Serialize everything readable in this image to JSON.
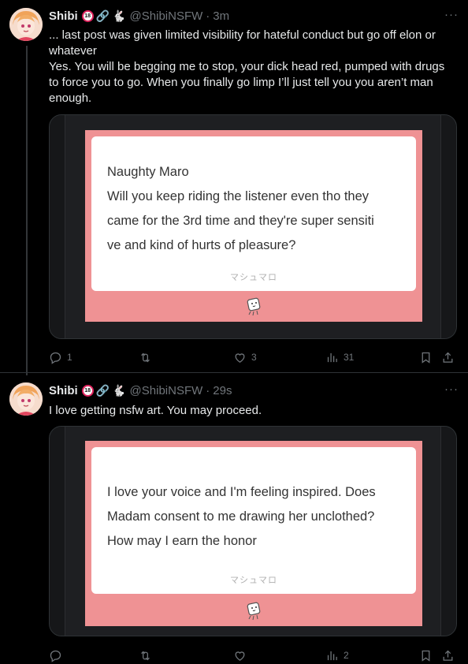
{
  "tweets": [
    {
      "name": "Shibi",
      "badge_18": "18",
      "handle": "@ShibiNSFW",
      "time": "3m",
      "more": "···",
      "text_lines": [
        "... last post was given limited visibility for hateful conduct but go off elon or whatever",
        "Yes. You will be begging me to stop, your dick head red, pumped with drugs to force you to go. When you finally go limp I’ll just tell you you aren’t man enough."
      ],
      "card": {
        "lines": [
          "Naughty Maro",
          "Will you keep riding the listener even tho they",
          "came for the 3rd time and they're super sensiti",
          "ve and kind of hurts of pleasure?"
        ],
        "brand": "マシュマロ"
      },
      "stats": {
        "replies": "1",
        "retweets": "",
        "likes": "3",
        "views": "31"
      }
    },
    {
      "name": "Shibi",
      "badge_18": "18",
      "handle": "@ShibiNSFW",
      "time": "29s",
      "more": "···",
      "text_lines": [
        "I love getting nsfw art. You may proceed."
      ],
      "card": {
        "lines": [
          "I love your voice and I'm feeling inspired. Does",
          "Madam consent to me drawing her unclothed?",
          "How may I earn the honor"
        ],
        "brand": "マシュマロ"
      },
      "stats": {
        "replies": "",
        "retweets": "",
        "likes": "",
        "views": "2"
      }
    }
  ],
  "colors": {
    "background": "#000000",
    "text": "#e7e9ea",
    "muted": "#71767b",
    "card_pink": "#ef9294",
    "divider": "#2f3336"
  },
  "icons": [
    "reply-icon",
    "retweet-icon",
    "like-icon",
    "views-icon",
    "bookmark-icon",
    "share-icon",
    "link-badge-icon",
    "rabbit-badge-icon",
    "marshmallow-mascot-icon"
  ]
}
